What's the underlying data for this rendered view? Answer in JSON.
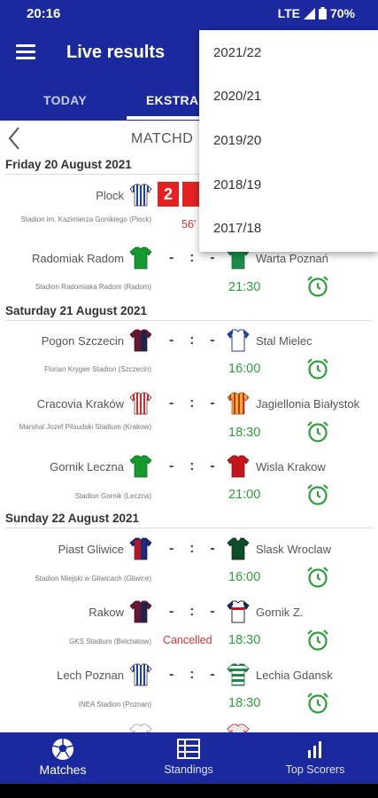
{
  "status": {
    "time": "20:16",
    "network": "LTE",
    "battery": "70%"
  },
  "app": {
    "title": "Live results"
  },
  "tabs": [
    {
      "label": "TODAY",
      "active": false
    },
    {
      "label": "EKSTRAK",
      "active": true
    }
  ],
  "matchday": {
    "title": "MATCHD"
  },
  "dates": [
    "Friday 20 August 2021",
    "Saturday 21 August 2021",
    "Sunday 22 August 2021"
  ],
  "matches": [
    {
      "home": "Plock",
      "away": "",
      "stadium": "Stadion im. Kazimierza Gorskiego (Plock)",
      "time": "",
      "status": "56'",
      "home_score": "2",
      "home_shirt": "stripes-blue-white",
      "away_shirt": ""
    },
    {
      "home": "Radomiak Radom",
      "away": "Warta Poznań",
      "stadium": "Stadion Radomiaka Radom (Radom)",
      "time": "21:30",
      "status": "",
      "home_shirt": "green",
      "away_shirt": "green-white"
    },
    {
      "home": "Pogon Szczecin",
      "away": "Stal Mielec",
      "stadium": "Florian Krygier Stadion (Szczecin)",
      "time": "16:00",
      "status": "",
      "home_shirt": "maroon-navy",
      "away_shirt": "white-blue"
    },
    {
      "home": "Cracovia Kraków",
      "away": "Jagiellonia Białystok",
      "stadium": "Marshal Jozef Pilsudski Stadium (Krakow)",
      "time": "18:30",
      "status": "",
      "home_shirt": "stripes-red-white",
      "away_shirt": "stripes-yellow-red"
    },
    {
      "home": "Gornik Leczna",
      "away": "Wisla Krakow",
      "stadium": "Stadion Gornik (Leczna)",
      "time": "21:00",
      "status": "",
      "home_shirt": "green",
      "away_shirt": "red"
    },
    {
      "home": "Piast Gliwice",
      "away": "Slask Wroclaw",
      "stadium": "Stadion Miejski w Gliwicach (Gliwice)",
      "time": "16:00",
      "status": "",
      "home_shirt": "red-blue",
      "away_shirt": "dark-green"
    },
    {
      "home": "Rakow",
      "away": "Gornik Z.",
      "stadium": "GKS Stadium (Belchatow)",
      "time": "18:30",
      "status": "Cancelled",
      "home_shirt": "maroon-navy",
      "away_shirt": "white-red"
    },
    {
      "home": "Lech Poznan",
      "away": "Lechia Gdansk",
      "stadium": "INEA Stadion (Poznan)",
      "time": "18:30",
      "status": "",
      "home_shirt": "stripes-blue-white",
      "away_shirt": "stripes-green-white"
    }
  ],
  "dropdown": [
    "2021/22",
    "2020/21",
    "2019/20",
    "2018/19",
    "2017/18"
  ],
  "bottom_nav": [
    {
      "label": "Matches",
      "icon": "football-icon",
      "active": true
    },
    {
      "label": "Standings",
      "icon": "table-icon",
      "active": false
    },
    {
      "label": "Top Scorers",
      "icon": "bar-chart-icon",
      "active": false
    }
  ],
  "colors": {
    "primary": "#1a2a9e",
    "time_green": "#2e9d3e",
    "live_red": "#e52222"
  }
}
